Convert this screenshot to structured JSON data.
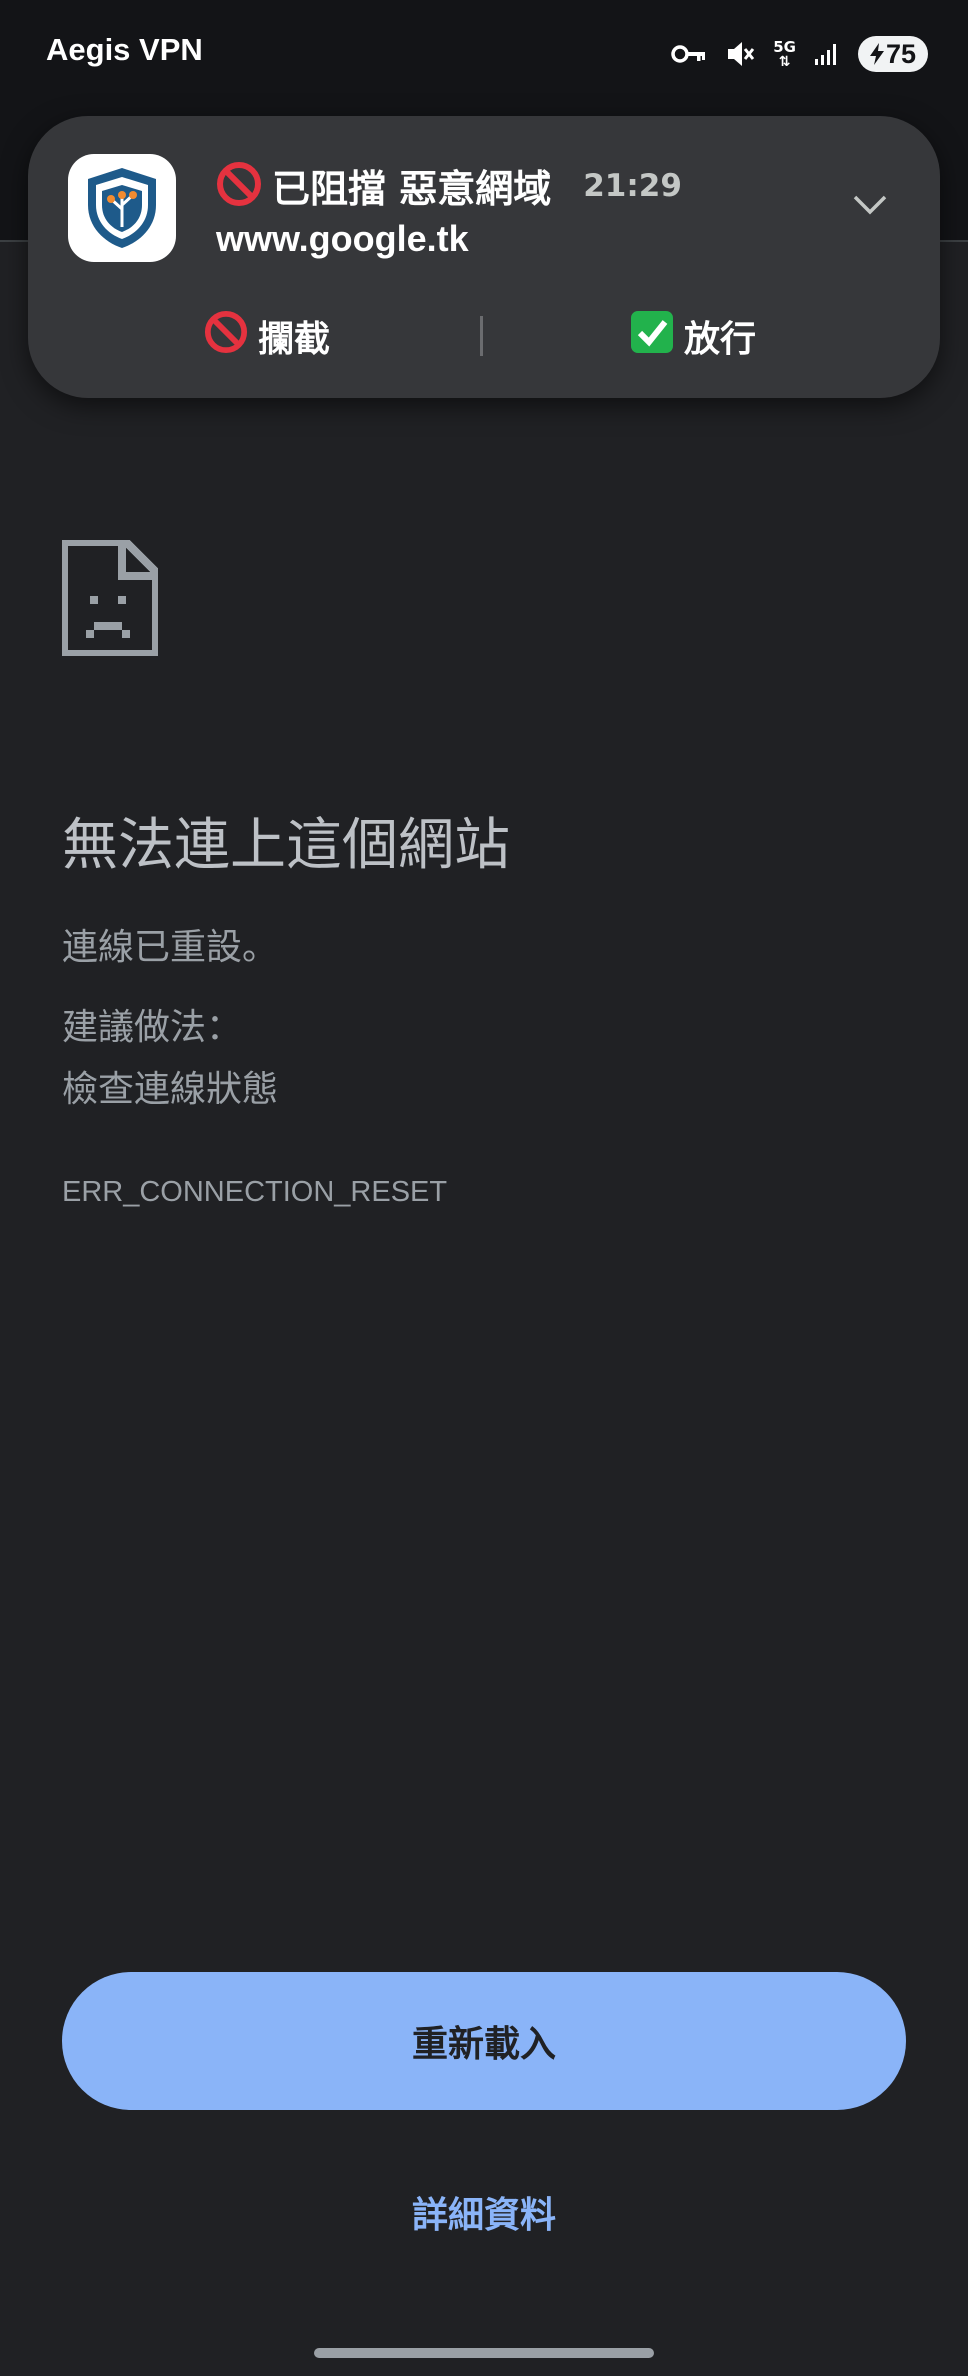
{
  "status_bar": {
    "app_name": "Aegis VPN",
    "network": "5G",
    "battery": "75"
  },
  "notification": {
    "title": "已阻擋 惡意網域",
    "time": "21:29",
    "domain": "www.google.tk",
    "block_label": "攔截",
    "allow_label": "放行",
    "block_icon": "prohibited-icon",
    "allow_icon": "check-mark-icon"
  },
  "error_page": {
    "title": "無法連上這個網站",
    "message": "連線已重設。",
    "suggestion_heading": "建議做法：",
    "suggestion_item": "檢查連線狀態",
    "error_code": "ERR_CONNECTION_RESET",
    "reload_label": "重新載入",
    "details_label": "詳細資料"
  },
  "colors": {
    "background": "#202124",
    "accent": "#8ab4f8",
    "notification_bg": "#36373a"
  }
}
